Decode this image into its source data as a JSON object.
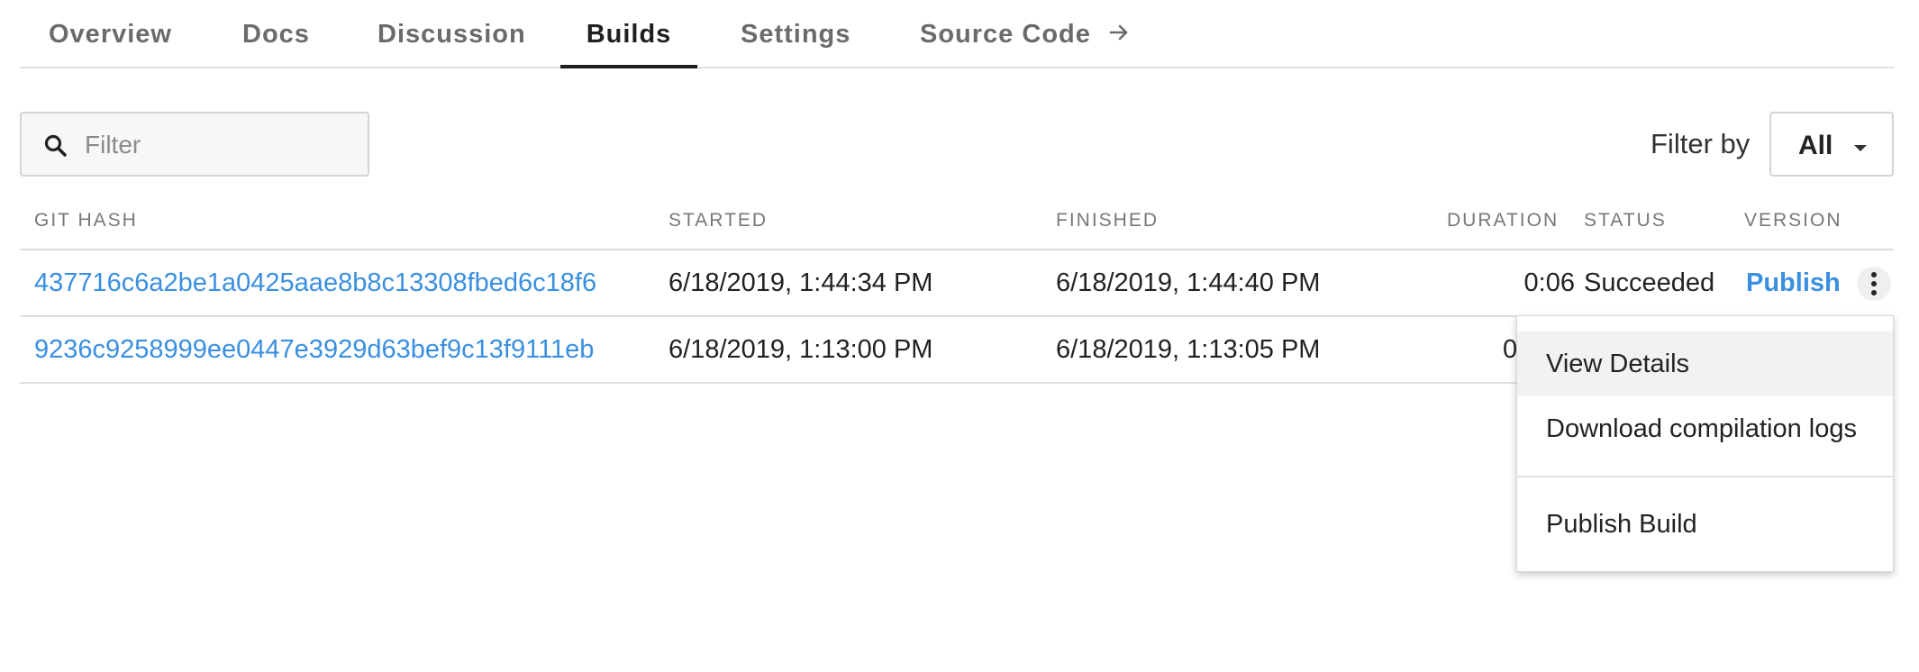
{
  "tabs": [
    {
      "label": "Overview",
      "active": false
    },
    {
      "label": "Docs",
      "active": false
    },
    {
      "label": "Discussion",
      "active": false
    },
    {
      "label": "Builds",
      "active": true
    },
    {
      "label": "Settings",
      "active": false
    },
    {
      "label": "Source Code",
      "active": false,
      "icon": "arrow-right-icon"
    }
  ],
  "filter": {
    "placeholder": "Filter",
    "value": "",
    "icon": "search-icon"
  },
  "filter_by": {
    "label": "Filter by",
    "selected": "All",
    "icon": "caret-down-icon"
  },
  "table": {
    "columns": [
      "GIT HASH",
      "STARTED",
      "FINISHED",
      "DURATION",
      "STATUS",
      "VERSION"
    ],
    "rows": [
      {
        "git_hash": "437716c6a2be1a0425aae8b8c13308fbed6c18f6",
        "started": "6/18/2019, 1:44:34 PM",
        "finished": "6/18/2019, 1:44:40 PM",
        "duration": "0:06",
        "status": "Succeeded",
        "version": "Publish"
      },
      {
        "git_hash": "9236c9258999ee0447e3929d63bef9c13f9111eb",
        "started": "6/18/2019, 1:13:00 PM",
        "finished": "6/18/2019, 1:13:05 PM",
        "duration": "0",
        "status": "",
        "version": ""
      }
    ]
  },
  "menu": {
    "items": [
      "View Details",
      "Download compilation logs",
      "Publish Build"
    ],
    "highlighted": "View Details"
  },
  "colors": {
    "link": "#3a8fe0",
    "active_tab": "#1f1f1f",
    "inactive_tab": "#6b6b6b",
    "divider": "#dedede"
  }
}
